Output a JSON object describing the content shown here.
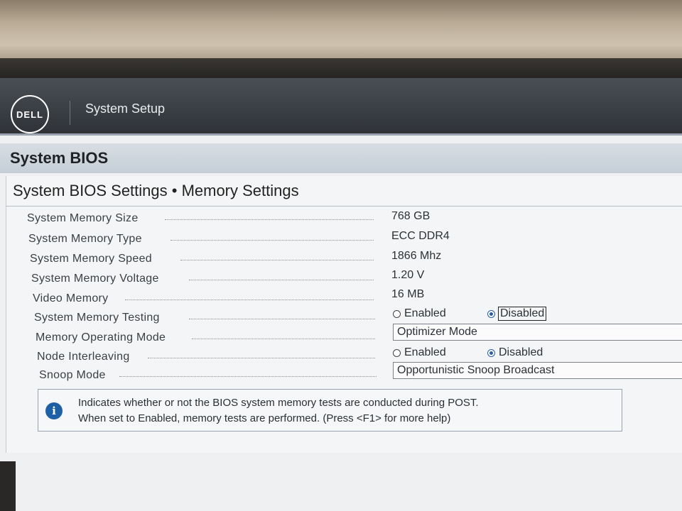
{
  "header": {
    "logo_text": "DELL",
    "app_title": "System Setup"
  },
  "section": {
    "title": "System BIOS"
  },
  "breadcrumb": "System BIOS Settings • Memory Settings",
  "settings": [
    {
      "label": "System Memory Size",
      "value": "768 GB"
    },
    {
      "label": "System Memory Type",
      "value": "ECC DDR4"
    },
    {
      "label": "System Memory Speed",
      "value": "1866 Mhz"
    },
    {
      "label": "System Memory Voltage",
      "value": "1.20 V"
    },
    {
      "label": "Video Memory",
      "value": "16 MB"
    },
    {
      "label": "System Memory Testing",
      "options": [
        "Enabled",
        "Disabled"
      ],
      "selected": "Disabled"
    },
    {
      "label": "Memory Operating Mode",
      "value": "Optimizer Mode"
    },
    {
      "label": "Node Interleaving",
      "options": [
        "Enabled",
        "Disabled"
      ],
      "selected": "Disabled"
    },
    {
      "label": "Snoop Mode",
      "value": "Opportunistic Snoop Broadcast"
    }
  ],
  "help": {
    "line1": "Indicates whether or not the BIOS system memory tests are conducted during POST.",
    "line2": "When set to Enabled, memory tests are performed. (Press <F1> for more help)"
  },
  "colors": {
    "header_bg": "#2f3338",
    "section_bg": "#c5ced7",
    "radio_selected": "#2a5fa8",
    "info_icon": "#1e5fa6"
  }
}
